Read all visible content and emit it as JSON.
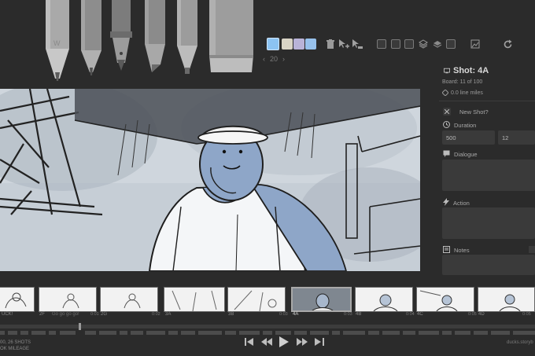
{
  "toolbar": {
    "brush_size": "20",
    "size_prev": "‹",
    "size_next": "›",
    "colors": [
      "#8cc3f2",
      "#d9d4c6",
      "#b9b3d8",
      "#97c1ec"
    ]
  },
  "shot": {
    "title": "Shot: 4A",
    "board": "Board: 11 of 100",
    "line_miles": "0.0 line miles",
    "new_shot_label": "New Shot?",
    "duration_label": "Duration",
    "duration_ms": "500",
    "duration_frames": "12",
    "dialogue_label": "Dialogue",
    "action_label": "Action",
    "notes_label": "Notes"
  },
  "timeline": {
    "thumbs": [
      {
        "label": "UCK!",
        "time": ""
      },
      {
        "label": "2F",
        "time": "0:01"
      },
      {
        "label": "Go go go go!",
        "time": ""
      },
      {
        "label": "2G",
        "time": "0:02"
      },
      {
        "label": "3A",
        "time": ""
      },
      {
        "label": "3B",
        "time": "0:03"
      },
      {
        "label": "4A",
        "time": "0:03"
      },
      {
        "label": "4B",
        "time": "0:04"
      },
      {
        "label": "4C",
        "time": "0:05"
      },
      {
        "label": "4D",
        "time": "0:05"
      }
    ],
    "status_line1": "00, 26 SHOTS",
    "status_line2": "OK MILEAGE",
    "project_name": "ducks.storyb"
  }
}
